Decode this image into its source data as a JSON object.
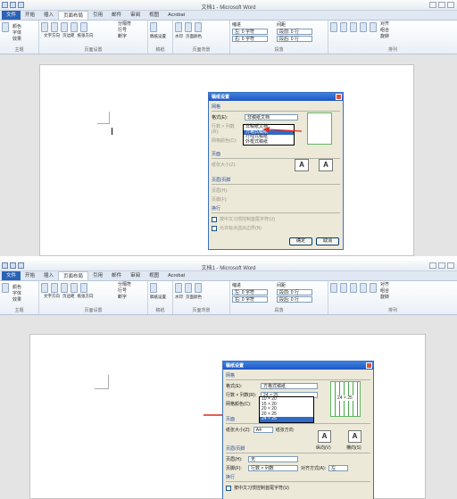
{
  "window": {
    "title": "文档1 - Microsoft Word"
  },
  "tabs": [
    "文件",
    "开始",
    "插入",
    "页面布局",
    "引用",
    "邮件",
    "审阅",
    "视图",
    "Acrobat"
  ],
  "ribbon": {
    "groups": [
      "主题",
      "页面设置",
      "稿纸",
      "页面背景",
      "段落",
      "排列"
    ],
    "buttons": [
      "文字方向",
      "页边距",
      "纸张方向",
      "纸张大小",
      "分栏",
      "稿纸设置",
      "水印",
      "页面颜色",
      "页面边框",
      "位置",
      "自动换行",
      "上移一层",
      "下移一层",
      "选择窗格"
    ],
    "theme_items": [
      "颜色",
      "字体",
      "效果"
    ],
    "page_setup_items": [
      "分隔符",
      "行号",
      "断字"
    ],
    "indent": {
      "label": "缩进",
      "left": "左: 0 字符",
      "right": "右: 0 字符"
    },
    "spacing": {
      "label": "间距",
      "before": "段前: 0 行",
      "after": "段后: 0 行"
    },
    "arrange_items": [
      "对齐",
      "组合",
      "旋转"
    ]
  },
  "dialog": {
    "title": "稿纸设置",
    "section_grid": "网格",
    "format_label": "格式(E):",
    "format_value": "方格式稿纸",
    "format_value_old": "非稿纸文档",
    "format_options": [
      "非稿纸文档",
      "方格式稿纸",
      "行线式稿纸",
      "外框式稿纸"
    ],
    "rowcol_label": "行数 × 列数(R):",
    "rowcol_value": "24 × 25",
    "rowcol_options": [
      "10 × 20",
      "15 × 20",
      "20 × 20",
      "20 × 25",
      "24 × 25"
    ],
    "grid_color_label": "网格颜色(C):",
    "page_section": "页面",
    "paper_size_label": "纸张大小(Z):",
    "paper_size_value": "A4",
    "orientation_label": "纸张方向",
    "portrait": "纵向(V)",
    "landscape": "横向(S)",
    "header_section": "页眉/页脚",
    "header_label": "页眉(H):",
    "header_value": "无",
    "footer_label": "页脚(F):",
    "footer_value": "行数 × 列数",
    "align_label": "对齐方式(A):",
    "align_value": "左",
    "wrap_section": "换行",
    "wrap_opt1": "按中文习惯控制首尾字符(U)",
    "wrap_opt2": "允许标点溢出边界(N)",
    "ok": "确定",
    "cancel": "取消",
    "preview_text": "24 × 25"
  },
  "colors": {
    "accent": "#2b62b5",
    "arrow": "#e0261a",
    "grid": "#45a845",
    "dialog_bg": "#ece9d8"
  }
}
